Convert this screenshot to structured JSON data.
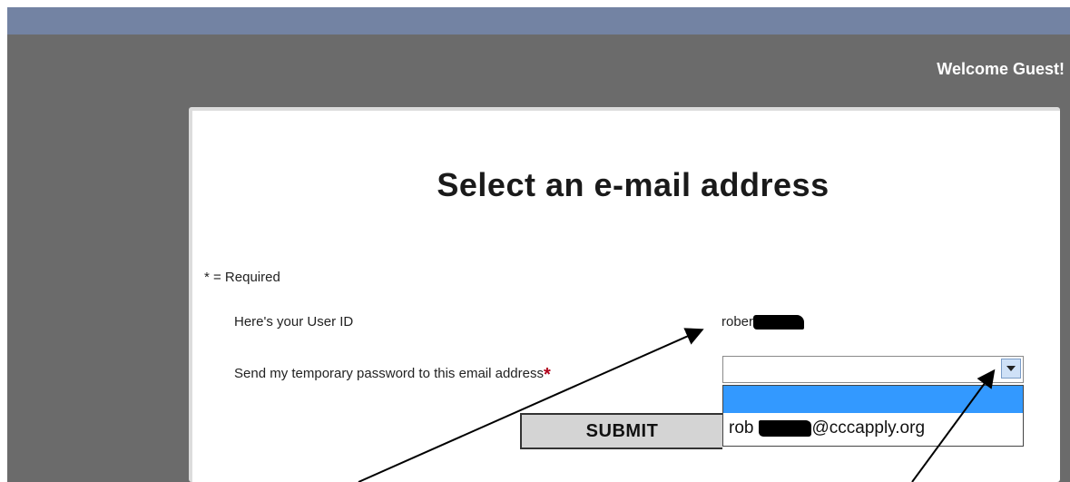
{
  "header": {
    "welcome": "Welcome Guest!"
  },
  "form": {
    "title": "Select an e-mail address",
    "required_note": "* = Required",
    "user_id_label": "Here's your User ID",
    "user_id_value": "rober",
    "email_label": "Send my temporary password to this email address",
    "required_mark": "*",
    "submit_label": "SUBMIT",
    "dropdown_options": [
      "",
      "rob"
    ],
    "dropdown_option_domain": "@cccapply.org"
  },
  "colors": {
    "navbar": "#7383a3",
    "panel": "#6b6b6b",
    "selection_blue": "#3399ff",
    "required_red": "#b0001a"
  }
}
